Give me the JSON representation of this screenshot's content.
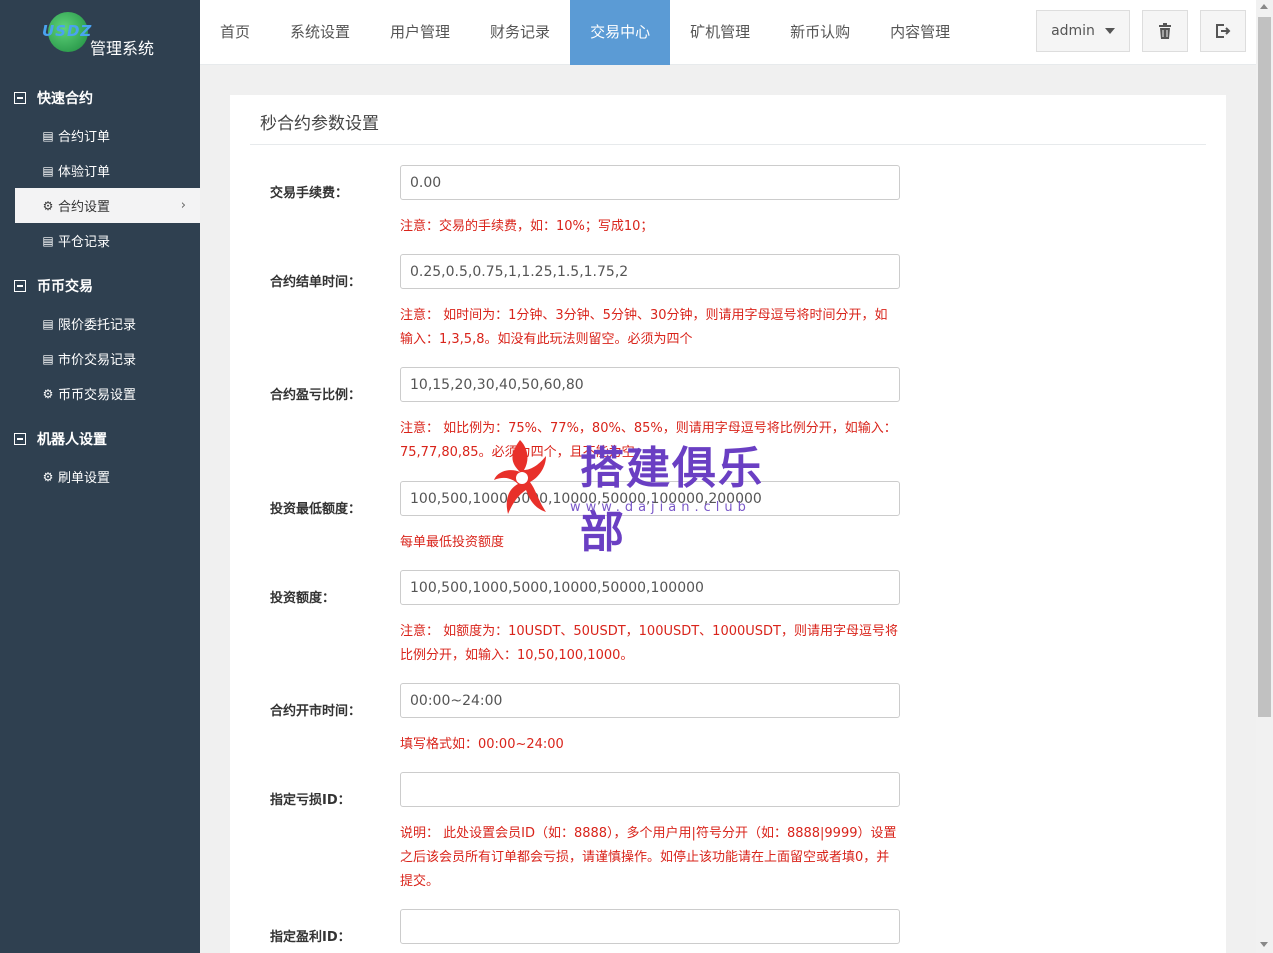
{
  "brand": {
    "logo_mark": "USDZ",
    "name": "管理系统"
  },
  "sidebar": {
    "groups": [
      {
        "title": "快速合约",
        "items": [
          {
            "icon": "list-icon",
            "label": "合约订单"
          },
          {
            "icon": "list-icon",
            "label": "体验订单"
          },
          {
            "icon": "gear-icon",
            "label": "合约设置",
            "active": true
          },
          {
            "icon": "list-icon",
            "label": "平仓记录"
          }
        ]
      },
      {
        "title": "币币交易",
        "items": [
          {
            "icon": "list-icon",
            "label": "限价委托记录"
          },
          {
            "icon": "list-icon",
            "label": "市价交易记录"
          },
          {
            "icon": "gear-icon",
            "label": "币币交易设置"
          }
        ]
      },
      {
        "title": "机器人设置",
        "items": [
          {
            "icon": "gear-icon",
            "label": "刷单设置"
          }
        ]
      }
    ]
  },
  "topnav": {
    "tabs": [
      "首页",
      "系统设置",
      "用户管理",
      "财务记录",
      "交易中心",
      "矿机管理",
      "新币认购",
      "内容管理"
    ],
    "active_tab": "交易中心",
    "user": "admin"
  },
  "panel": {
    "title": "秒合约参数设置",
    "fields": [
      {
        "label": "交易手续费：",
        "value": "0.00",
        "note": "注意：交易的手续费，如：10%；写成10；"
      },
      {
        "label": "合约结单时间：",
        "value": "0.25,0.5,0.75,1,1.25,1.5,1.75,2",
        "note": "注意： 如时间为：1分钟、3分钟、5分钟、30分钟，则请用字母逗号将时间分开，如输入：1,3,5,8。如没有此玩法则留空。必须为四个"
      },
      {
        "label": "合约盈亏比例：",
        "value": "10,15,20,30,40,50,60,80",
        "note": "注意： 如比例为：75%、77%，80%、85%，则请用字母逗号将比例分开，如输入：75,77,80,85。必须为四个，且不能为空"
      },
      {
        "label": "投资最低额度：",
        "value": "100,500,1000,5000,10000,50000,100000,200000",
        "note": "每单最低投资额度"
      },
      {
        "label": "投资额度：",
        "value": "100,500,1000,5000,10000,50000,100000",
        "note": "注意： 如额度为：10USDT、50USDT，100USDT、1000USDT，则请用字母逗号将比例分开，如输入：10,50,100,1000。"
      },
      {
        "label": "合约开市时间：",
        "value": "00:00~24:00",
        "note": "填写格式如：00:00~24:00"
      },
      {
        "label": "指定亏损ID：",
        "value": "",
        "note": "说明： 此处设置会员ID（如：8888），多个用户用|符号分开（如：8888|9999）设置之后该会员所有订单都会亏损，请谨慎操作。如停止该功能请在上面留空或者填0，并提交。"
      },
      {
        "label": "指定盈利ID：",
        "value": "",
        "note": ""
      }
    ]
  },
  "watermark": {
    "text": "搭建俱乐部",
    "url": "www.dajian.club"
  },
  "colors": {
    "sidebar_bg": "#2f4050",
    "active_tab": "#5b9bd5",
    "note_red": "#d9241b"
  }
}
